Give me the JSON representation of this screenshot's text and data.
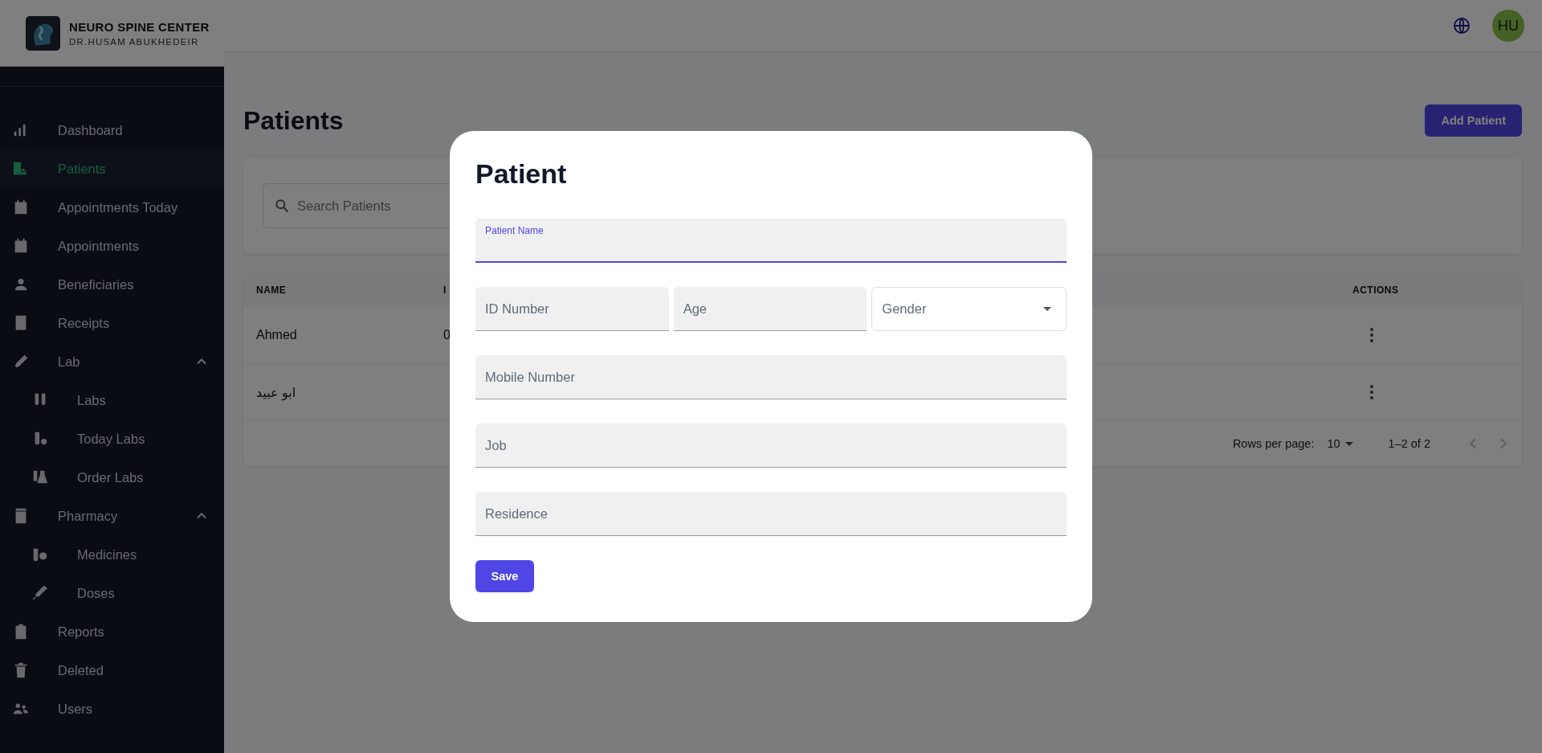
{
  "brand": {
    "title": "NEURO SPINE CENTER",
    "subtitle": "DR.HUSAM ABUKHEDEIR"
  },
  "sidebar": {
    "items": [
      {
        "label": "Dashboard",
        "selected": false
      },
      {
        "label": "Patients",
        "selected": true
      },
      {
        "label": "Appointments Today",
        "selected": false
      },
      {
        "label": "Appointments",
        "selected": false
      },
      {
        "label": "Beneficiaries",
        "selected": false
      },
      {
        "label": "Receipts",
        "selected": false
      },
      {
        "label": "Lab",
        "selected": false,
        "expanded": true,
        "children": [
          {
            "label": "Labs",
            "selected": false
          },
          {
            "label": "Today Labs",
            "selected": false
          },
          {
            "label": "Order Labs",
            "selected": false
          }
        ]
      },
      {
        "label": "Pharmacy",
        "selected": false,
        "expanded": true,
        "children": [
          {
            "label": "Medicines",
            "selected": false
          },
          {
            "label": "Doses",
            "selected": false
          }
        ]
      },
      {
        "label": "Reports",
        "selected": false
      },
      {
        "label": "Deleted",
        "selected": false
      },
      {
        "label": "Users",
        "selected": false
      }
    ]
  },
  "header": {
    "avatar": "HU"
  },
  "page": {
    "title": "Patients",
    "add_button": "Add Patient"
  },
  "search": {
    "placeholder": "Search Patients"
  },
  "table": {
    "columns": [
      "NAME",
      "I",
      "ACTIONS"
    ],
    "rows": [
      {
        "cells": [
          "Ahmed",
          "0"
        ]
      },
      {
        "cells": [
          "ابو عبيد",
          ""
        ]
      }
    ],
    "pagination": {
      "rows_label": "Rows per page:",
      "rows_value": "10",
      "range": "1–2 of 2"
    }
  },
  "modal": {
    "title": "Patient",
    "rows": [
      {
        "fields": [
          {
            "kind": "text",
            "label": "Patient Name",
            "focused": true
          }
        ]
      },
      {
        "fields": [
          {
            "kind": "text",
            "label": "ID Number",
            "focused": false
          },
          {
            "kind": "text",
            "label": "Age",
            "focused": false
          },
          {
            "kind": "select",
            "label": "Gender",
            "focused": false
          }
        ]
      },
      {
        "fields": [
          {
            "kind": "text",
            "label": "Mobile Number",
            "focused": false
          }
        ]
      },
      {
        "fields": [
          {
            "kind": "text",
            "label": "Job",
            "focused": false
          }
        ]
      },
      {
        "fields": [
          {
            "kind": "text",
            "label": "Residence",
            "focused": false
          }
        ]
      }
    ],
    "save_button": "Save"
  }
}
